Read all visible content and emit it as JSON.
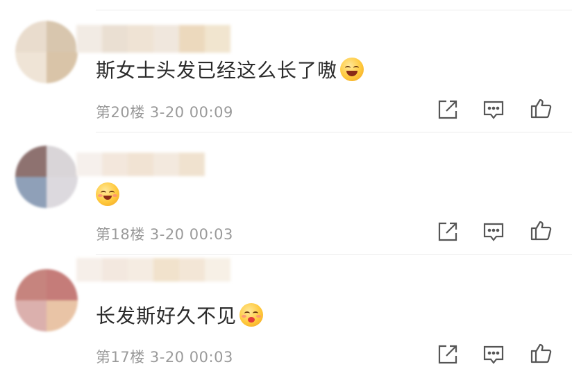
{
  "comments": [
    {
      "text": "斯女士头发已经这么长了嗷",
      "emoji": "grinning-sweat-emoji",
      "floor": "第20楼",
      "date": "3-20",
      "time": "00:09",
      "avatar_colors": [
        "#e9dccd",
        "#d8c6ae",
        "#efe4d6",
        "#d9c4a8"
      ],
      "name_colors": [
        "#f2ebe4",
        "#eadfd2",
        "#efe3d4",
        "#f0e7dd",
        "#ecd9bd",
        "#f1e5cf"
      ]
    },
    {
      "text": "",
      "emoji": "hugging-emoji",
      "floor": "第18楼",
      "date": "3-20",
      "time": "00:03",
      "avatar_colors": [
        "#8e7270",
        "#d9d5d8",
        "#8fa0b8",
        "#dcd9de"
      ],
      "name_colors": [
        "#f6f0ec",
        "#f3e7dc",
        "#f1e3d3",
        "#f3e9de",
        "#f0e2cf"
      ]
    },
    {
      "text": "长发斯好久不见",
      "emoji": "blowing-kiss-emoji",
      "floor": "第17楼",
      "date": "3-20",
      "time": "00:03",
      "avatar_colors": [
        "#c6847e",
        "#c57c79",
        "#dbb0ad",
        "#e9c4a6"
      ],
      "name_colors": [
        "#f6efe9",
        "#f3e8df",
        "#f5ece2",
        "#f1e2cc",
        "#f3e6d6",
        "#f7f0e6"
      ]
    }
  ],
  "actions": [
    "share-icon",
    "comment-icon",
    "like-icon"
  ],
  "colors": {
    "text": "#2b2b2b",
    "meta": "#9a9a9a",
    "divider": "#ececec",
    "icon": "#555555"
  }
}
